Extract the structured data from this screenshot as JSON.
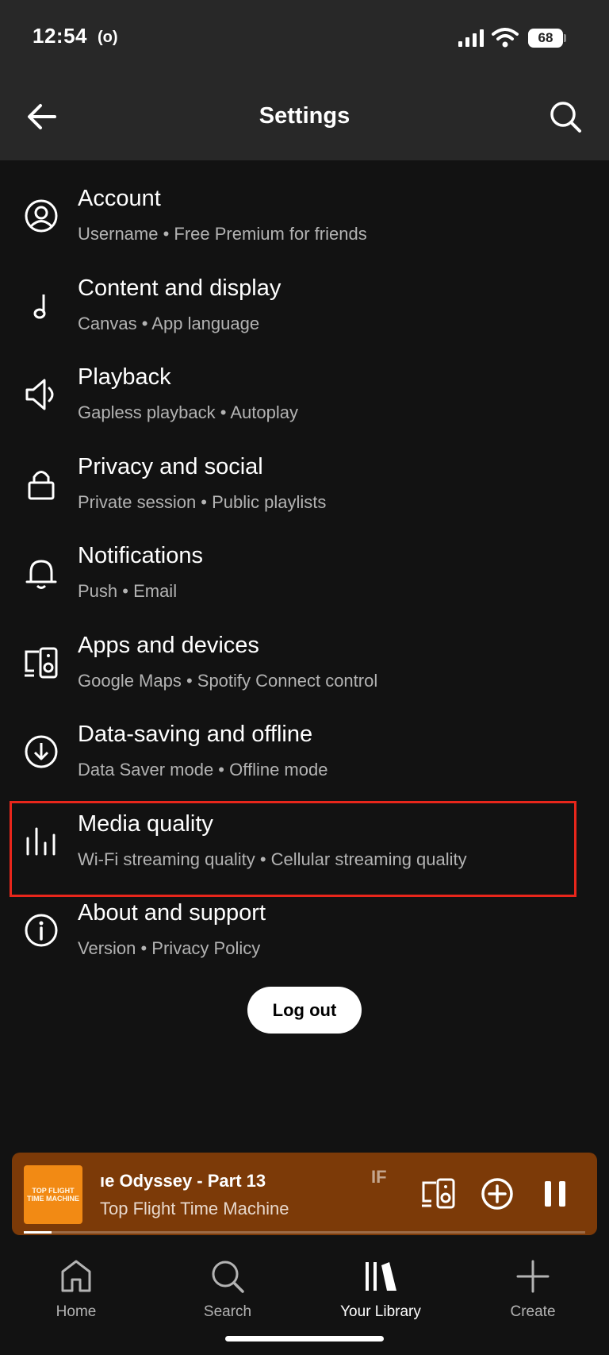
{
  "status_bar": {
    "time": "12:54",
    "broadcast_symbol": "(o)",
    "battery_level": "68"
  },
  "header": {
    "title": "Settings"
  },
  "settings": [
    {
      "title": "Account",
      "subtitle": "Username • Free Premium for friends",
      "icon": "account-icon"
    },
    {
      "title": "Content and display",
      "subtitle": "Canvas • App language",
      "icon": "music-note-icon"
    },
    {
      "title": "Playback",
      "subtitle": "Gapless playback • Autoplay",
      "icon": "speaker-icon"
    },
    {
      "title": "Privacy and social",
      "subtitle": "Private session • Public playlists",
      "icon": "lock-icon"
    },
    {
      "title": "Notifications",
      "subtitle": "Push • Email",
      "icon": "bell-icon"
    },
    {
      "title": "Apps and devices",
      "subtitle": "Google Maps • Spotify Connect control",
      "icon": "devices-icon"
    },
    {
      "title": "Data-saving and offline",
      "subtitle": "Data Saver mode • Offline mode",
      "icon": "download-icon"
    },
    {
      "title": "Media quality",
      "subtitle": "Wi-Fi streaming quality • Cellular streaming quality",
      "icon": "bars-icon",
      "highlighted": true
    },
    {
      "title": "About and support",
      "subtitle": "Version • Privacy Policy",
      "icon": "info-icon"
    }
  ],
  "logout_label": "Log out",
  "mini_player": {
    "track_title": "ıe Odyssey - Part 13",
    "track_title_continuation": "IF",
    "artist": "Top Flight Time Machine",
    "album_art_text": "TOP FLIGHT TIME MACHINE",
    "progress": 0.05
  },
  "bottom_nav": [
    {
      "label": "Home",
      "icon": "home-icon",
      "active": false
    },
    {
      "label": "Search",
      "icon": "search-icon",
      "active": false
    },
    {
      "label": "Your Library",
      "icon": "library-icon",
      "active": true
    },
    {
      "label": "Create",
      "icon": "plus-icon",
      "active": false
    }
  ],
  "colors": {
    "background": "#121212",
    "header": "#282828",
    "highlight_border": "#e8261b",
    "mini_player": "#7c3a08",
    "subtitle": "#b3b3b3"
  }
}
